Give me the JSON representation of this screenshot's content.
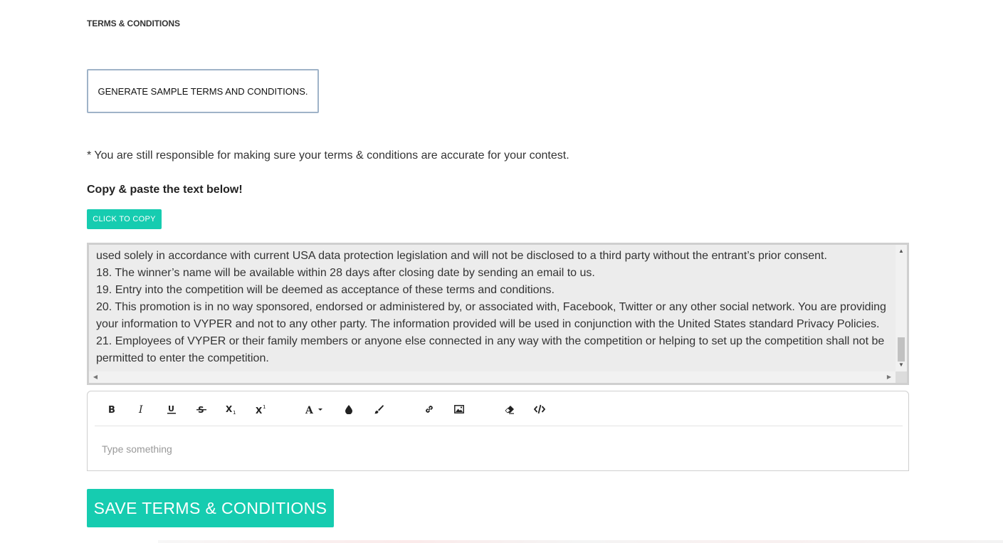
{
  "section": {
    "title": "TERMS & CONDITIONS"
  },
  "generate_button": {
    "label": "GENERATE SAMPLE TERMS AND CONDITIONS."
  },
  "note": "* You are still responsible for making sure your terms & conditions are accurate for your contest.",
  "copy_heading": "Copy & paste the text below!",
  "copy_button": {
    "label": "CLICK TO COPY"
  },
  "terms_text": {
    "lines": [
      "used solely in accordance with current USA data protection legislation and will not be disclosed to a third party without the entrant’s prior consent.",
      "18. The winner’s name will be available within 28 days after closing date by sending an email to us.",
      "19. Entry into the competition will be deemed as acceptance of these terms and conditions.",
      "20. This promotion is in no way sponsored, endorsed or administered by, or associated with, Facebook, Twitter or any other social network. You are providing your information to VYPER and not to any other party. The information provided will be used in conjunction with the United States standard Privacy Policies.",
      "21. Employees of VYPER or their family members or anyone else connected in any way with the competition or helping to set up the competition shall not be permitted to enter the competition."
    ]
  },
  "editor": {
    "placeholder": "Type something",
    "toolbar": [
      "bold-icon",
      "italic-icon",
      "underline-icon",
      "strikethrough-icon",
      "subscript-icon",
      "superscript-icon",
      "font-icon",
      "color-drop-icon",
      "brush-icon",
      "link-icon",
      "image-icon",
      "eraser-icon",
      "code-icon"
    ]
  },
  "save_button": {
    "label": "SAVE TERMS & CONDITIONS"
  },
  "colors": {
    "accent": "#16ccb0",
    "textarea_bg": "#ececec"
  }
}
